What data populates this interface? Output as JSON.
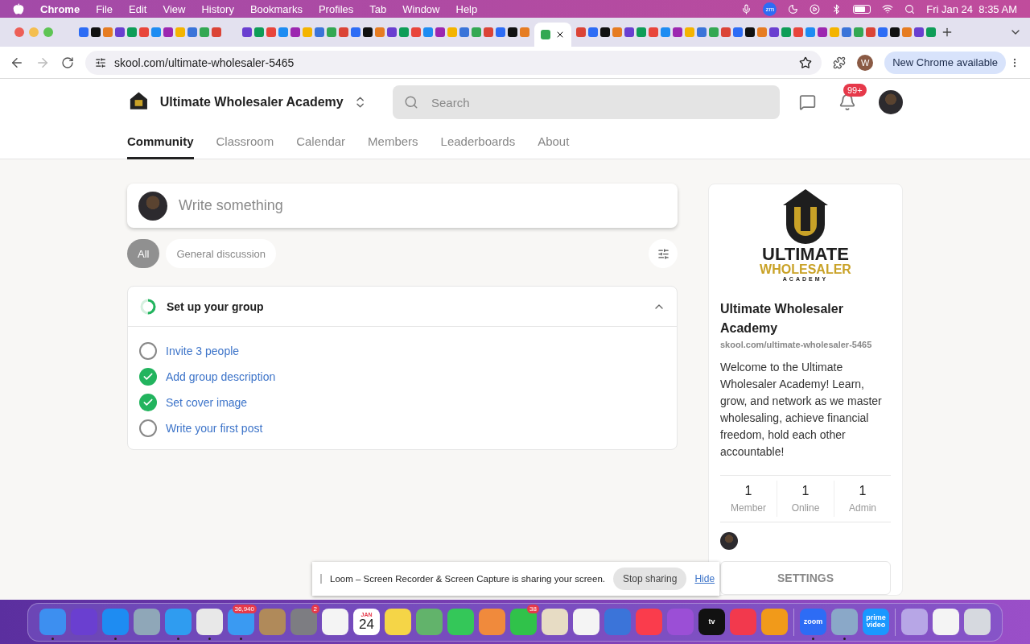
{
  "menu_bar": {
    "app": "Chrome",
    "items": [
      "File",
      "Edit",
      "View",
      "History",
      "Bookmarks",
      "Profiles",
      "Tab",
      "Window",
      "Help"
    ],
    "zoom_label": "zm",
    "date": "Fri Jan 24",
    "time": "8:35 AM"
  },
  "browser": {
    "url": "skool.com/ultimate-wholesaler-5465",
    "profile_initial": "W",
    "update_button": "New Chrome available"
  },
  "header": {
    "group_name": "Ultimate Wholesaler Academy",
    "search_placeholder": "Search",
    "notification_count": "99+"
  },
  "nav_tabs": [
    {
      "label": "Community",
      "selected": true
    },
    {
      "label": "Classroom",
      "selected": false
    },
    {
      "label": "Calendar",
      "selected": false
    },
    {
      "label": "Members",
      "selected": false
    },
    {
      "label": "Leaderboards",
      "selected": false
    },
    {
      "label": "About",
      "selected": false
    }
  ],
  "composer": {
    "placeholder": "Write something"
  },
  "filters": [
    {
      "label": "All",
      "selected": true
    },
    {
      "label": "General discussion",
      "selected": false
    }
  ],
  "setup": {
    "title": "Set up your group",
    "expanded": true,
    "tasks": [
      {
        "label": "Invite 3 people",
        "checked": false
      },
      {
        "label": "Add group description",
        "checked": true
      },
      {
        "label": "Set cover image",
        "checked": true
      },
      {
        "label": "Write your first post",
        "checked": false
      }
    ]
  },
  "about_card": {
    "logo_lines": [
      "ULTIMATE",
      "WHOLESALER",
      "ACADEMY"
    ],
    "name": "Ultimate Wholesaler Academy",
    "url": "skool.com/ultimate-wholesaler-5465",
    "description": "Welcome to the Ultimate Wholesaler Academy! Learn, grow, and network as we master wholesaling, achieve financial freedom, hold each other accountable!",
    "stats": [
      {
        "value": "1",
        "label": "Member"
      },
      {
        "value": "1",
        "label": "Online"
      },
      {
        "value": "1",
        "label": "Admin"
      }
    ],
    "settings_button": "SETTINGS"
  },
  "loom_bar": {
    "message": "Loom – Screen Recorder & Screen Capture is sharing your screen.",
    "stop_button": "Stop sharing",
    "hide_link": "Hide"
  },
  "dock": {
    "items": [
      {
        "kind": "app",
        "color": "#3d8ff0",
        "running": true
      },
      {
        "kind": "app",
        "color": "#6a3fd0",
        "running": false
      },
      {
        "kind": "app",
        "color": "#1e8cf2",
        "running": true
      },
      {
        "kind": "app",
        "color": "#8fa7b8",
        "running": false
      },
      {
        "kind": "app",
        "color": "#2f9cf0",
        "running": true
      },
      {
        "kind": "app",
        "color": "#e8e8e8",
        "running": true
      },
      {
        "kind": "app",
        "color": "#3a9af2",
        "running": true,
        "badge": "36,940"
      },
      {
        "kind": "app",
        "color": "#b08a5a",
        "running": false
      },
      {
        "kind": "app",
        "color": "#7d7d82",
        "running": false,
        "badge": "2"
      },
      {
        "kind": "app",
        "color": "#f4f4f4",
        "running": false
      },
      {
        "kind": "calendar",
        "month": "JAN",
        "day": "24",
        "running": false
      },
      {
        "kind": "app",
        "color": "#f5d547",
        "running": false
      },
      {
        "kind": "app",
        "color": "#62b36b",
        "running": false
      },
      {
        "kind": "app",
        "color": "#34c759",
        "running": false
      },
      {
        "kind": "app",
        "color": "#f08a3c",
        "running": false
      },
      {
        "kind": "app",
        "color": "#30c24a",
        "running": false,
        "badge": "38"
      },
      {
        "kind": "app",
        "color": "#e7dcc4",
        "running": false
      },
      {
        "kind": "app",
        "color": "#f4f4f4",
        "running": false
      },
      {
        "kind": "app",
        "color": "#3b74d9",
        "running": false
      },
      {
        "kind": "app",
        "color": "#fa3c4c",
        "running": false
      },
      {
        "kind": "app",
        "color": "#9b4fd6",
        "running": false
      },
      {
        "kind": "label",
        "label": "tv",
        "color": "#111111",
        "running": false
      },
      {
        "kind": "app",
        "color": "#f2394d",
        "running": false
      },
      {
        "kind": "app",
        "color": "#f19a1a",
        "running": false
      },
      {
        "kind": "separator"
      },
      {
        "kind": "label",
        "label": "zoom",
        "color": "#2d6cf5",
        "running": true
      },
      {
        "kind": "app",
        "color": "#8aa8c8",
        "running": true
      },
      {
        "kind": "label",
        "label": "prime video",
        "color": "#1a98ff",
        "running": false
      },
      {
        "kind": "separator"
      },
      {
        "kind": "app",
        "color": "#b7a6e6",
        "running": false
      },
      {
        "kind": "app",
        "color": "#f4f4f4",
        "running": false
      },
      {
        "kind": "app",
        "color": "#d6d9df",
        "running": false
      }
    ]
  }
}
